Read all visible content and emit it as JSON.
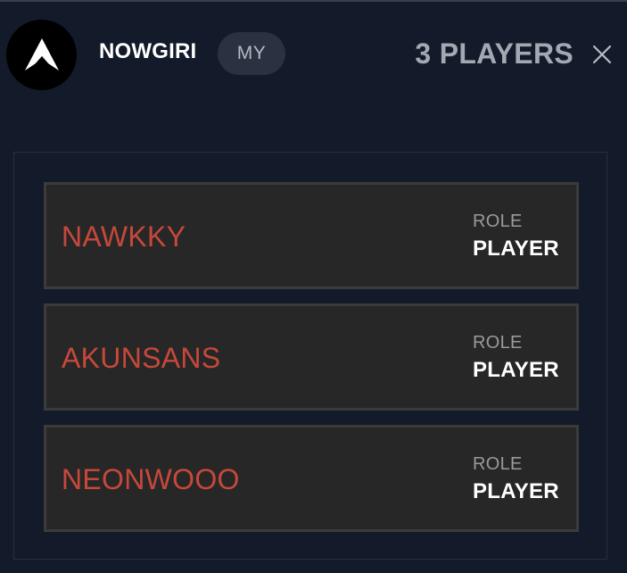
{
  "header": {
    "team_name": "NOWGIRI",
    "badge": "MY",
    "player_count": "3 PLAYERS",
    "logo_icon": "apex-logo-icon",
    "close_icon": "close-icon"
  },
  "roster": [
    {
      "name": "NAWKKY",
      "role_label": "ROLE",
      "role": "PLAYER"
    },
    {
      "name": "AKUNSANS",
      "role_label": "ROLE",
      "role": "PLAYER"
    },
    {
      "name": "NEONWOOO",
      "role_label": "ROLE",
      "role": "PLAYER"
    }
  ],
  "colors": {
    "background": "#131a29",
    "player_name": "#c6483a",
    "row_background": "#272727",
    "badge_background": "#2a3140"
  }
}
